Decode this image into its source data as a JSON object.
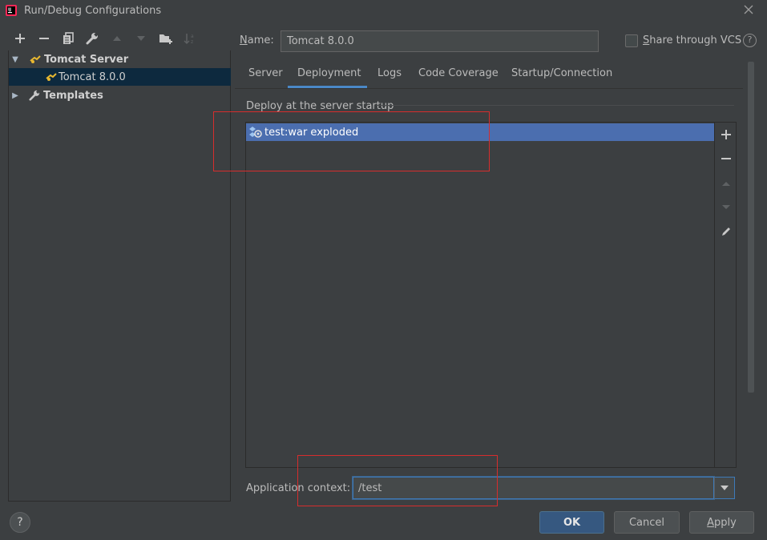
{
  "window": {
    "title": "Run/Debug Configurations"
  },
  "toolbar": {
    "icons": [
      "add-icon",
      "remove-icon",
      "copy-icon",
      "wrench-icon",
      "move-up-icon",
      "move-down-icon",
      "new-folder-icon",
      "sort-icon"
    ]
  },
  "tree": {
    "group_label": "Tomcat Server",
    "config_label": "Tomcat 8.0.0",
    "templates_label": "Templates"
  },
  "name_field": {
    "label_underlined": "N",
    "label_rest": "ame:",
    "value": "Tomcat 8.0.0"
  },
  "share": {
    "label_underlined": "S",
    "label_rest": "hare through VCS",
    "checked": false
  },
  "tabs": [
    "Server",
    "Deployment",
    "Logs",
    "Code Coverage",
    "Startup/Connection"
  ],
  "active_tab": "Deployment",
  "deployment": {
    "section_label": "Deploy at the server startup",
    "items": [
      "test:war exploded"
    ]
  },
  "app_context": {
    "label": "Application context:",
    "value": "/test"
  },
  "buttons": {
    "ok": "OK",
    "cancel": "Cancel",
    "apply_underlined": "A",
    "apply_rest": "pply"
  },
  "help": "?",
  "colors": {
    "selection": "#4b6eaf",
    "accent": "#4a88c7",
    "annotation": "#d62d2d",
    "ok_button": "#365880"
  }
}
